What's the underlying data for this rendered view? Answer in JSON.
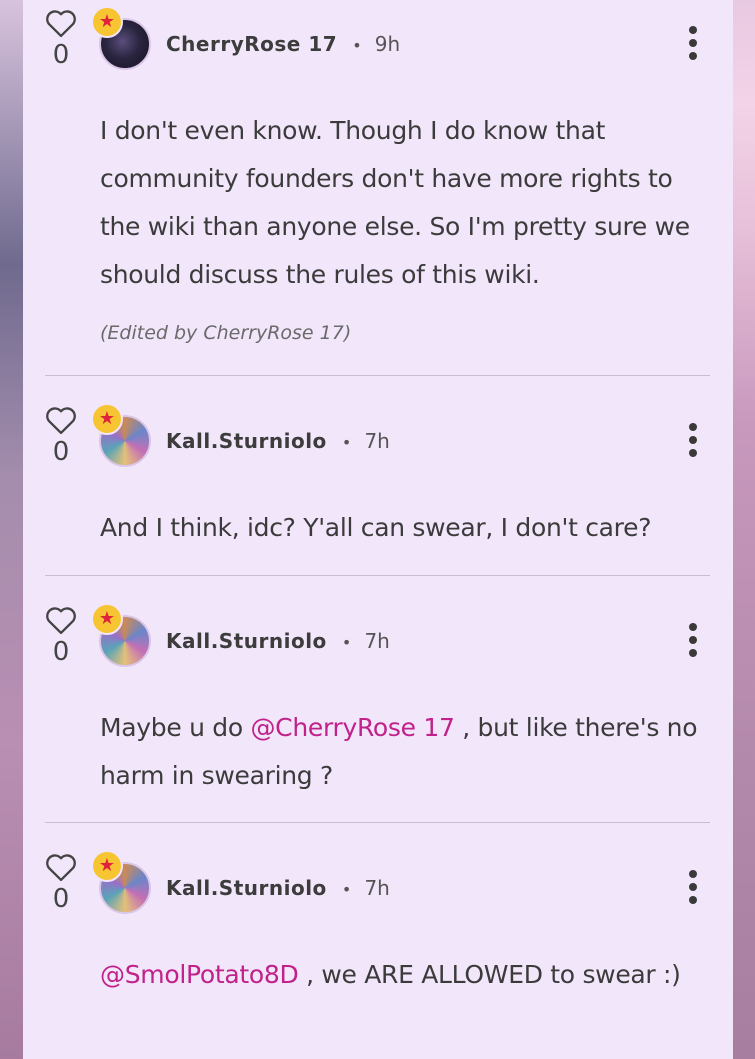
{
  "comments": [
    {
      "like_count": "0",
      "username": "CherryRose 17",
      "time": "9h",
      "text": "I don't even know. Though I do know that community founders don't have more rights to the wiki than anyone else. So I'm pretty sure we should discuss the rules of this wiki.",
      "edited": "(Edited by CherryRose 17)"
    },
    {
      "like_count": "0",
      "username": "Kall.Sturniolo",
      "time": "7h",
      "text": "And I think, idc? Y'all can swear, I don't care?"
    },
    {
      "like_count": "0",
      "username": "Kall.Sturniolo",
      "time": "7h",
      "text_before": "Maybe u do ",
      "mention": "@CherryRose 17",
      "text_after": " , but like there's no harm in swearing ?"
    },
    {
      "like_count": "0",
      "username": "Kall.Sturniolo",
      "time": "7h",
      "mention": "@SmolPotato8D",
      "text_after": " , we ARE ALLOWED  to swear :)"
    }
  ],
  "icons": {
    "like": "heart-outline-icon",
    "badge": "star-badge-icon",
    "more": "more-vertical-icon"
  },
  "colors": {
    "panel": "#f2e6fa",
    "mention": "#c0218a",
    "badge": "#f7c531",
    "badge_star": "#e0223a"
  }
}
